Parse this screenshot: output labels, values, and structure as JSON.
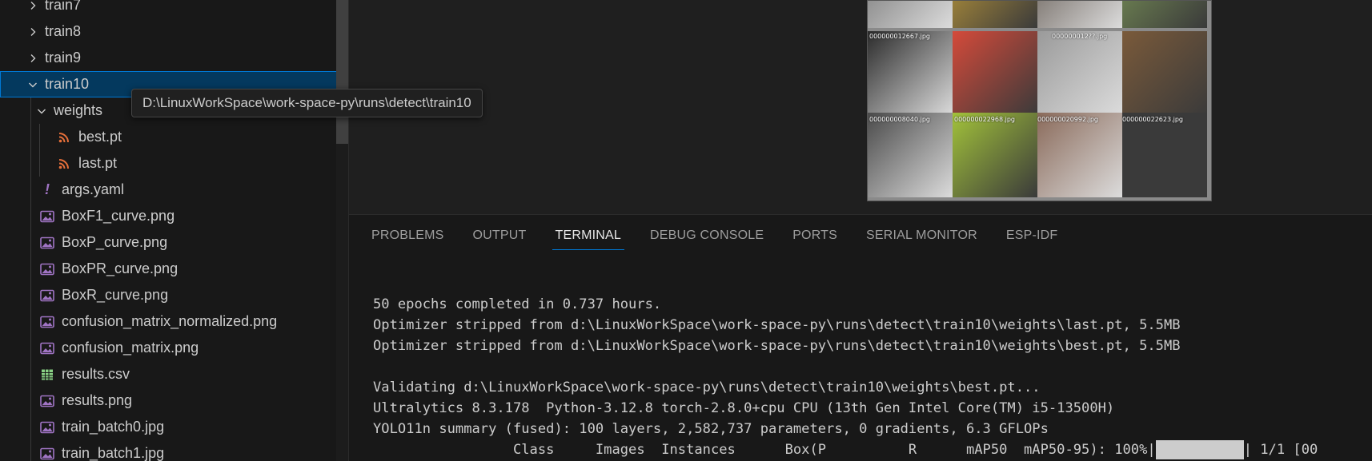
{
  "explorer": {
    "items": [
      {
        "label": "train7",
        "type": "folder",
        "expanded": false,
        "level": 0
      },
      {
        "label": "train8",
        "type": "folder",
        "expanded": false,
        "level": 0
      },
      {
        "label": "train9",
        "type": "folder",
        "expanded": false,
        "level": 0
      },
      {
        "label": "train10",
        "type": "folder",
        "expanded": true,
        "level": 0,
        "selected": true
      },
      {
        "label": "weights",
        "type": "folder",
        "expanded": true,
        "level": 1
      },
      {
        "label": "best.pt",
        "type": "pt-file",
        "level": 2
      },
      {
        "label": "last.pt",
        "type": "pt-file",
        "level": 2
      },
      {
        "label": "args.yaml",
        "type": "yaml-file",
        "level": 1
      },
      {
        "label": "BoxF1_curve.png",
        "type": "image-file",
        "level": 1
      },
      {
        "label": "BoxP_curve.png",
        "type": "image-file",
        "level": 1
      },
      {
        "label": "BoxPR_curve.png",
        "type": "image-file",
        "level": 1
      },
      {
        "label": "BoxR_curve.png",
        "type": "image-file",
        "level": 1
      },
      {
        "label": "confusion_matrix_normalized.png",
        "type": "image-file",
        "level": 1
      },
      {
        "label": "confusion_matrix.png",
        "type": "image-file",
        "level": 1
      },
      {
        "label": "results.csv",
        "type": "csv-file",
        "level": 1
      },
      {
        "label": "results.png",
        "type": "image-file",
        "level": 1
      },
      {
        "label": "train_batch0.jpg",
        "type": "image-file",
        "level": 1
      },
      {
        "label": "train_batch1.jpg",
        "type": "image-file",
        "level": 1
      }
    ],
    "tooltip": "D:\\LinuxWorkSpace\\work-space-py\\runs\\detect\\train10"
  },
  "preview": {
    "tile_labels": [
      "000000012667.jpg",
      "000000012??.jpg",
      "000000008040.jpg",
      "000000022968.jpg",
      "000000020992.jpg",
      "000000022623.jpg"
    ]
  },
  "panel": {
    "tabs": [
      "PROBLEMS",
      "OUTPUT",
      "TERMINAL",
      "DEBUG CONSOLE",
      "PORTS",
      "SERIAL MONITOR",
      "ESP-IDF"
    ],
    "active_tab": "TERMINAL"
  },
  "terminal": {
    "lines": [
      "50 epochs completed in 0.737 hours.",
      "Optimizer stripped from d:\\LinuxWorkSpace\\work-space-py\\runs\\detect\\train10\\weights\\last.pt, 5.5MB",
      "Optimizer stripped from d:\\LinuxWorkSpace\\work-space-py\\runs\\detect\\train10\\weights\\best.pt, 5.5MB",
      "",
      "Validating d:\\LinuxWorkSpace\\work-space-py\\runs\\detect\\train10\\weights\\best.pt...",
      "Ultralytics 8.3.178  Python-3.12.8 torch-2.8.0+cpu CPU (13th Gen Intel Core(TM) i5-13500H)",
      "YOLO11n summary (fused): 100 layers, 2,582,737 parameters, 0 gradients, 6.3 GFLOPs"
    ],
    "progress_prefix": "                 Class     Images  Instances      Box(P          R      mAP50  mAP50-95): 100%|",
    "progress_suffix": "| 1/1 [00",
    "progress_fraction": 1.0
  },
  "colors": {
    "selection_bg": "#04395e",
    "focus_border": "#0078d4",
    "pt_icon": "#e8703a",
    "yaml_icon": "#a074c4",
    "image_icon": "#a074c4",
    "csv_icon": "#89d185"
  }
}
